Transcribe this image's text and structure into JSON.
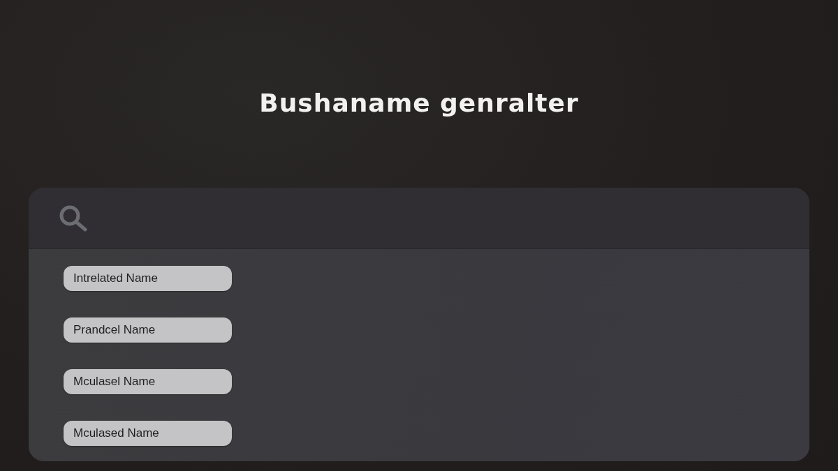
{
  "title": "Bushaname genralter",
  "names": [
    "Intrelated Name",
    "Prandcel Name",
    "Mculasel Name",
    "Mculased Name"
  ]
}
